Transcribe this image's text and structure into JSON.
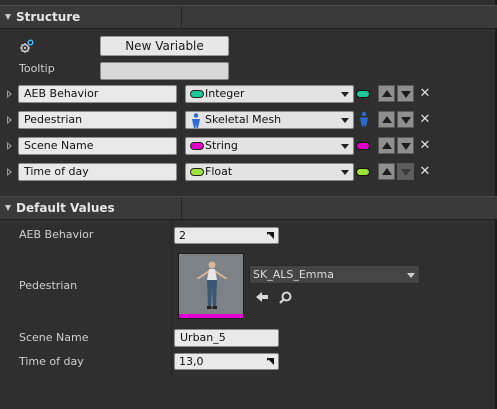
{
  "structure": {
    "title": "Structure",
    "new_variable_label": "New Variable",
    "tooltip_label": "Tooltip",
    "tooltip_value": "",
    "members": [
      {
        "name": "AEB Behavior",
        "type": "Integer",
        "type_color": "#1fc79a",
        "type_icon": "pill-icon",
        "arrows": [
          "up-enabled",
          "down-enabled"
        ]
      },
      {
        "name": "Pedestrian",
        "type": "Skeletal Mesh",
        "type_color": "#2a6bd4",
        "type_icon": "skeletal-mesh-icon",
        "arrows": [
          "up-enabled",
          "down-enabled"
        ]
      },
      {
        "name": "Scene Name",
        "type": "String",
        "type_color": "#e000c8",
        "type_icon": "pill-icon",
        "arrows": [
          "up-enabled",
          "down-enabled"
        ]
      },
      {
        "name": "Time of day",
        "type": "Float",
        "type_color": "#9ee33a",
        "type_icon": "pill-icon",
        "arrows": [
          "up-enabled",
          "down-disabled"
        ]
      }
    ]
  },
  "defaults": {
    "title": "Default Values",
    "aeb_label": "AEB Behavior",
    "aeb_value": "2",
    "pedestrian_label": "Pedestrian",
    "pedestrian_asset": "SK_ALS_Emma",
    "scene_label": "Scene Name",
    "scene_value": "Urban_5",
    "time_label": "Time of day",
    "time_value": "13,0"
  },
  "icons": {
    "gear": "gear-icon",
    "delete": "x-icon",
    "use_selected": "arrow-left-icon",
    "browse": "magnifier-icon"
  }
}
